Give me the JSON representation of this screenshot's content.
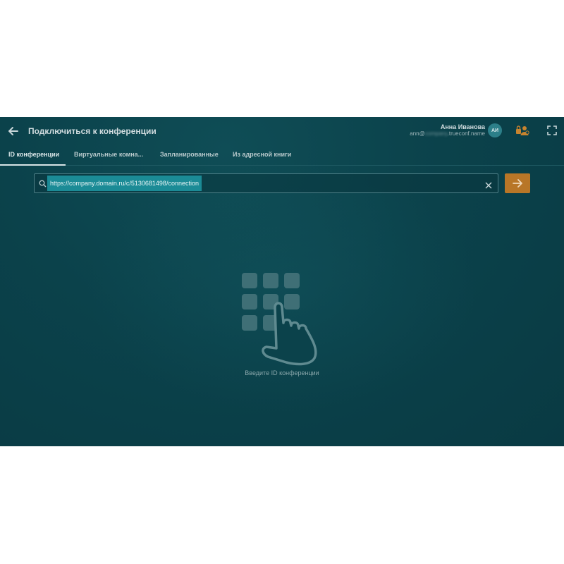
{
  "header": {
    "title": "Подключиться к конференции",
    "user_name": "Анна Иванова",
    "user_email_prefix": "ann@",
    "user_email_masked": "company",
    "user_email_suffix": ".trueconf.name",
    "avatar_initials": "АИ"
  },
  "tabs": [
    {
      "label": "ID конференции",
      "active": true
    },
    {
      "label": "Виртуальные комна..."
    },
    {
      "label": "Запланированные"
    },
    {
      "label": "Из адресной книги"
    }
  ],
  "search": {
    "value": "https://company.domain.ru/c/5130681498/connection"
  },
  "main": {
    "hint": "Введите ID конференции"
  },
  "colors": {
    "background": "#0b424b",
    "accent": "#b87627",
    "selection": "#1b8b96"
  }
}
